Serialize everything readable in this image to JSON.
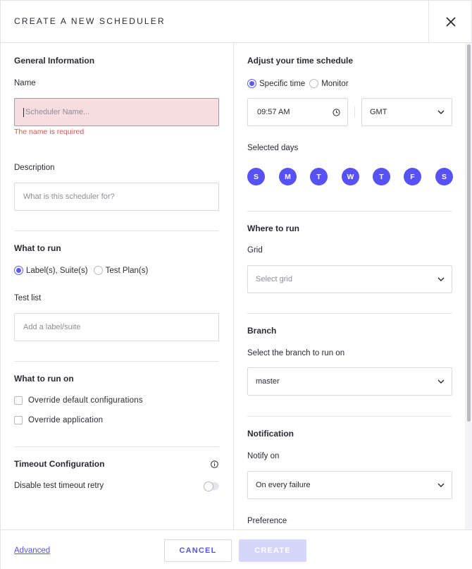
{
  "header": {
    "title": "CREATE A NEW SCHEDULER"
  },
  "left": {
    "general_title": "General Information",
    "name_label": "Name",
    "name_placeholder": "Scheduler Name...",
    "name_error": "The name is required",
    "description_label": "Description",
    "description_placeholder": "What is this scheduler for?",
    "what_to_run_title": "What to run",
    "run_options": [
      {
        "label": "Label(s), Suite(s)",
        "selected": true
      },
      {
        "label": "Test Plan(s)",
        "selected": false
      }
    ],
    "test_list_label": "Test list",
    "test_list_placeholder": "Add a label/suite",
    "what_to_run_on_title": "What to run on",
    "checkboxes": [
      {
        "label": "Override default configurations",
        "checked": false
      },
      {
        "label": "Override application",
        "checked": false
      }
    ],
    "timeout_title": "Timeout Configuration",
    "timeout_retry_label": "Disable test timeout retry",
    "timeout_retry_on": false
  },
  "right": {
    "schedule_title": "Adjust your time schedule",
    "schedule_modes": [
      {
        "label": "Specific time",
        "selected": true
      },
      {
        "label": "Monitor",
        "selected": false
      }
    ],
    "time_value": "09:57 AM",
    "timezone_value": "GMT",
    "selected_days_label": "Selected days",
    "days": [
      "S",
      "M",
      "T",
      "W",
      "T",
      "F",
      "S"
    ],
    "where_title": "Where to run",
    "grid_label": "Grid",
    "grid_placeholder": "Select grid",
    "branch_title": "Branch",
    "branch_label": "Select the branch to run on",
    "branch_value": "master",
    "notification_title": "Notification",
    "notify_label": "Notify on",
    "notify_value": "On every failure",
    "preference_label": "Preference"
  },
  "footer": {
    "advanced": "Advanced",
    "cancel": "CANCEL",
    "create": "CREATE"
  },
  "colors": {
    "accent": "#5652f5",
    "error": "#d9534f",
    "error_bg": "#f7dde0",
    "create_disabled": "#d6d6fb"
  }
}
